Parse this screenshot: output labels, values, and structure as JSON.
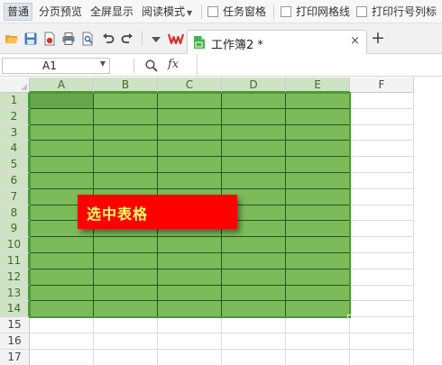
{
  "ribbon": {
    "normal_label": "普通",
    "page_break_preview_label": "分页预览",
    "full_screen_label": "全屏显示",
    "reading_mode_label": "阅读模式",
    "task_pane_label": "任务窗格",
    "print_gridlines_label": "打印网格线",
    "print_headings_label": "打印行号列标"
  },
  "toolbar": {
    "icons": [
      "open-folder-icon",
      "save-icon",
      "export-pdf-icon",
      "print-icon",
      "print-preview-icon",
      "undo-icon",
      "redo-icon",
      "customize-dropdown-icon",
      "wps-logo-icon"
    ]
  },
  "tab": {
    "title": "工作簿2 *",
    "close_symbol": "×",
    "new_tab_symbol": "+"
  },
  "formula_bar": {
    "name_box_value": "A1",
    "fx_label": "fx",
    "formula_value": ""
  },
  "sheet": {
    "columns": [
      "A",
      "B",
      "C",
      "D",
      "E",
      "F"
    ],
    "rows": [
      "1",
      "2",
      "3",
      "4",
      "5",
      "6",
      "7",
      "8",
      "9",
      "10",
      "11",
      "12",
      "13",
      "14",
      "15",
      "16",
      "17"
    ],
    "selection": "A1:E14",
    "selection_color": "#7cba5a"
  },
  "annotation": {
    "text": "选中表格",
    "background": "#ff0000",
    "text_color": "#ffff66"
  }
}
